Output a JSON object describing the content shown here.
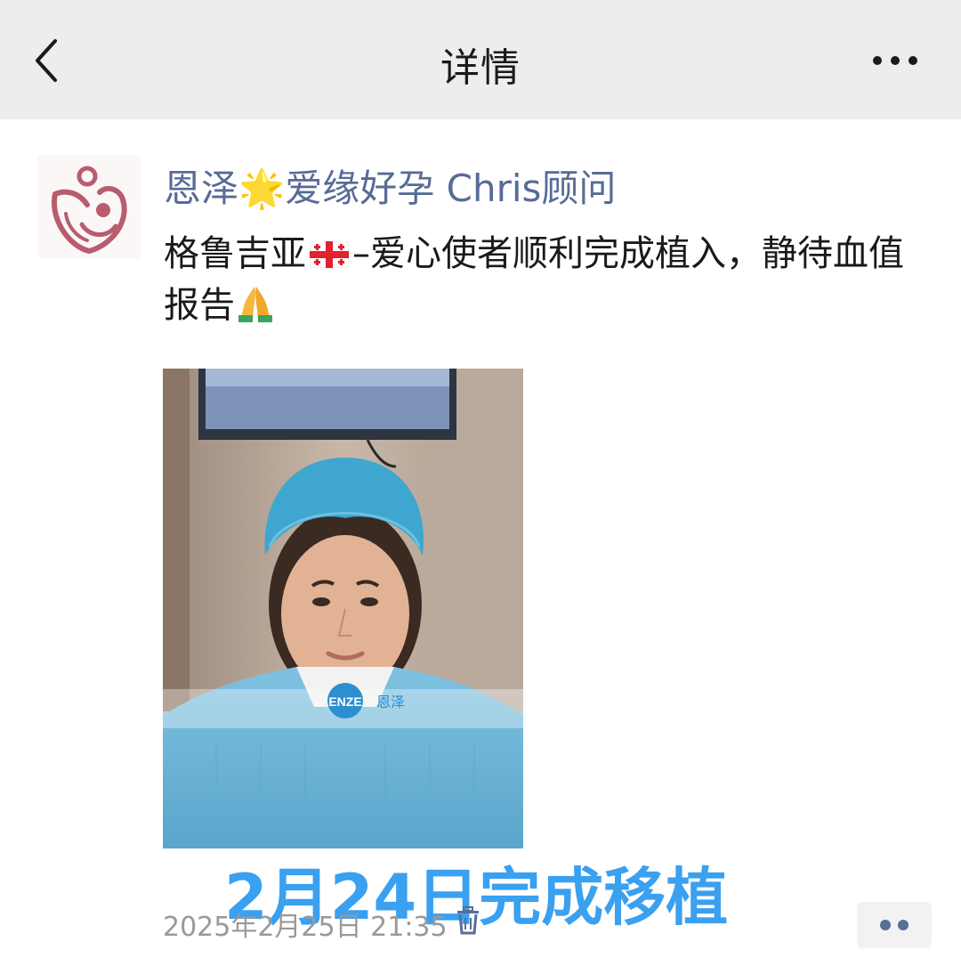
{
  "header": {
    "title": "详情",
    "back_icon": "chevron-left-icon",
    "more_icon": "more-horizontal-icon"
  },
  "post": {
    "author": "恩泽🌟爱缘好孕 Chris顾问",
    "text_part1": "格鲁吉亚",
    "text_part2": "–爱心使者顺利完成植入，静待血值报告",
    "flag_icon": "georgia-flag-icon",
    "pray_icon": "praying-hands-icon",
    "photo_watermark": "ENZE 恩泽",
    "image_caption": "2月24日完成移植",
    "timestamp": "2025年2月25日 21:35",
    "delete_icon": "trash-icon",
    "comment_icon": "comment-dots-icon"
  },
  "colors": {
    "link_blue": "#576b95",
    "caption_blue": "#3aa0f0",
    "topbar_bg": "#ededed",
    "avatar_logo": "#b85c6e"
  }
}
